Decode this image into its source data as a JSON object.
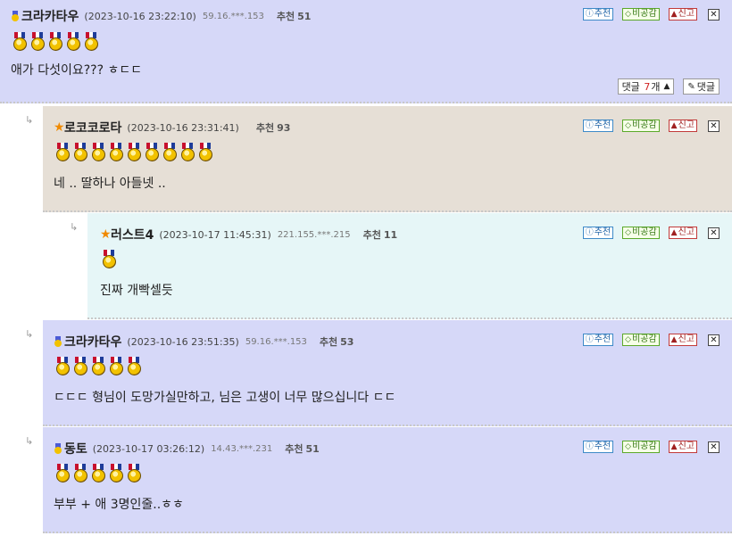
{
  "comments": [
    {
      "nick": "크라카타우",
      "level_icon": "medal",
      "date": "(2023-10-16 23:22:10)",
      "ip": "59.16.***.153",
      "rec_label": "추천",
      "rec_count": "51",
      "medal_count": 5,
      "text": "애가 다섯이요??? ㅎㄷㄷ",
      "bg": "#d6d8f8"
    },
    {
      "nick": "로코코로타",
      "level_icon": "star",
      "date": "(2023-10-16 23:31:41)",
      "ip": "",
      "rec_label": "추천",
      "rec_count": "93",
      "medal_count": 9,
      "text": "네 .. 딸하나 아들넷 ..",
      "bg": "#e6dfd6"
    },
    {
      "nick": "러스트4",
      "level_icon": "star",
      "date": "(2023-10-17 11:45:31)",
      "ip": "221.155.***.215",
      "rec_label": "추천",
      "rec_count": "11",
      "medal_count": 1,
      "text": "진짜 개빡셀듯",
      "bg": "#e6f6f7"
    },
    {
      "nick": "크라카타우",
      "level_icon": "medal",
      "date": "(2023-10-16 23:51:35)",
      "ip": "59.16.***.153",
      "rec_label": "추천",
      "rec_count": "53",
      "medal_count": 5,
      "text": "ㄷㄷㄷ 형님이 도망가실만하고, 님은 고생이 너무 많으십니다 ㄷㄷ",
      "bg": "#d6d8f8"
    },
    {
      "nick": "동토",
      "level_icon": "medal",
      "date": "(2023-10-17 03:26:12)",
      "ip": "14.43.***.231",
      "rec_label": "추천",
      "rec_count": "51",
      "medal_count": 5,
      "text": "부부 + 애 3명인줄..ㅎㅎ",
      "bg": "#d6d8f8"
    }
  ],
  "actions": {
    "recommend": "추천",
    "nonpublic": "비공감",
    "report": "신고",
    "close": "✕"
  },
  "reply_bar": {
    "count_prefix": "댓글",
    "count": "7",
    "count_suffix": "개",
    "write_label": "댓글"
  }
}
